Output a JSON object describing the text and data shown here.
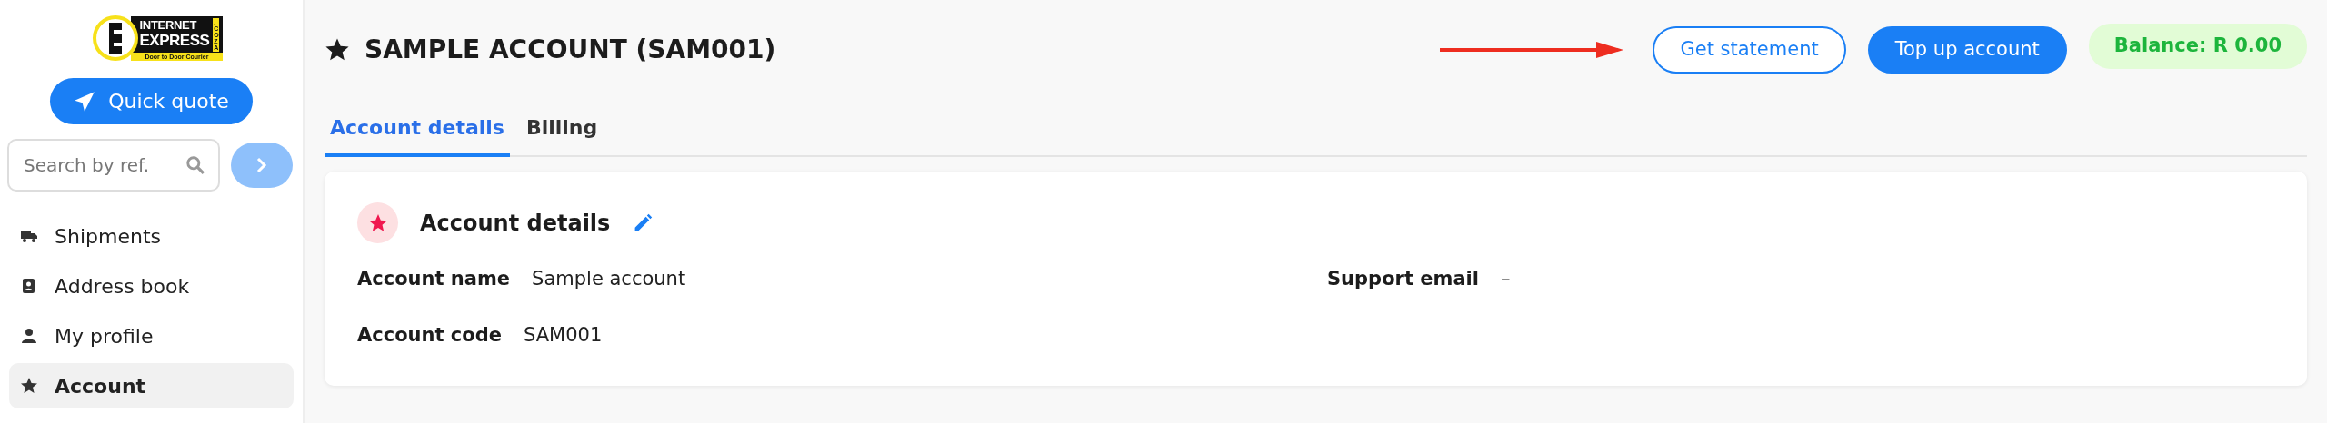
{
  "logo": {
    "line_1": "INTERNET",
    "line_2": "EXPRESS",
    "domain": ".CO.ZA",
    "tagline": "Door to Door Courier"
  },
  "quick_quote": {
    "label": "Quick quote"
  },
  "search": {
    "placeholder": "Search by ref."
  },
  "sidebar": {
    "items": [
      {
        "label": "Shipments",
        "selected": false
      },
      {
        "label": "Address book",
        "selected": false
      },
      {
        "label": "My profile",
        "selected": false
      },
      {
        "label": "Account",
        "selected": true
      }
    ]
  },
  "header": {
    "title": "SAMPLE ACCOUNT (SAM001)",
    "buttons": [
      {
        "label": "Get statement",
        "kind": "outline"
      },
      {
        "label": "Top up account",
        "kind": "solid"
      }
    ],
    "balance": "Balance: R 0.00"
  },
  "tabs": [
    {
      "label": "Account details",
      "selected": true
    },
    {
      "label": "Billing",
      "selected": false
    }
  ],
  "card": {
    "title": "Account details",
    "rows": [
      [
        {
          "label": "Account name",
          "value": "Sample account"
        },
        {
          "label": "Support email",
          "value": "–"
        }
      ],
      [
        {
          "label": "Account code",
          "value": "SAM001"
        }
      ]
    ]
  }
}
